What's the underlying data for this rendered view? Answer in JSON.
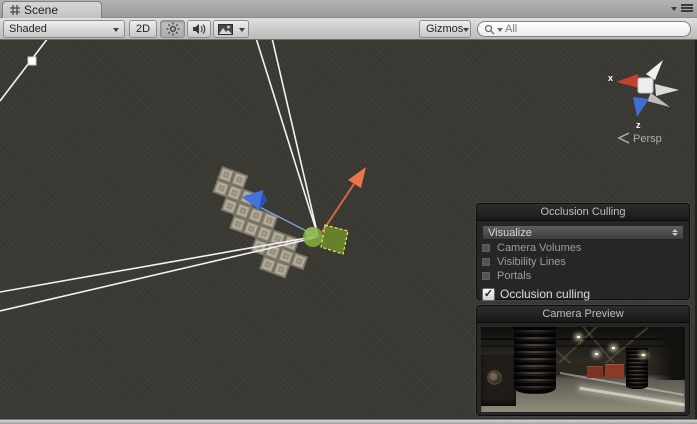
{
  "tab": {
    "title": "Scene"
  },
  "toolbar": {
    "shading_mode": "Shaded",
    "btn_2d": "2D",
    "gizmos_label": "Gizmos",
    "search_value": "All"
  },
  "scene": {
    "axis_labels": {
      "x": "x",
      "z": "z",
      "mode": "Persp"
    }
  },
  "panels": {
    "occlusion": {
      "title": "Occlusion Culling",
      "visualize": "Visualize",
      "items": [
        {
          "label": "Camera Volumes",
          "enabled": true
        },
        {
          "label": "Visibility Lines",
          "enabled": false
        },
        {
          "label": "Portals",
          "enabled": false
        }
      ],
      "toggle_label": "Occlusion culling",
      "toggle_checked": true,
      "checkmark": "✓"
    },
    "camera_preview": {
      "title": "Camera Preview"
    }
  },
  "colors": {
    "scene_bg": "#3b3933",
    "gizmo_arrow_orange": "#e8754b",
    "camera_gizmo_blue": "#4374da",
    "occlusion_green": "#86af3e",
    "selection_outline_yellow": "#e9e960",
    "axis_x_red": "#c5402e",
    "axis_z_blue": "#3f6ed2"
  }
}
